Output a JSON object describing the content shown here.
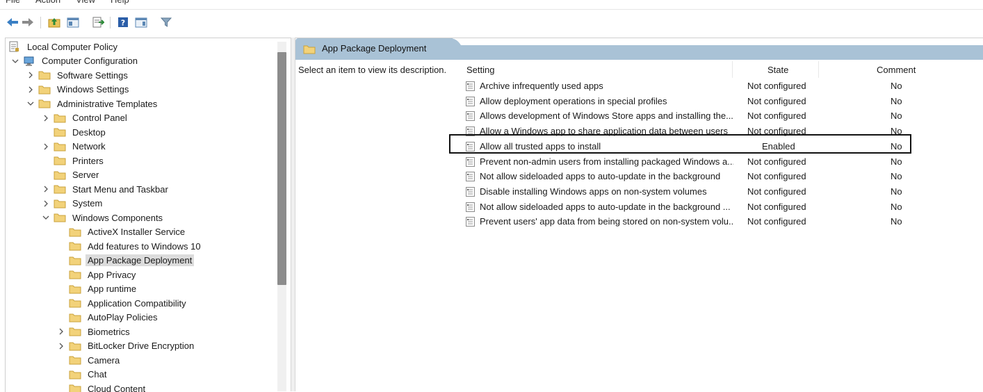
{
  "menubar": {
    "items": [
      "File",
      "Action",
      "View",
      "Help"
    ]
  },
  "toolbar": {
    "icons": [
      "back-arrow-icon",
      "forward-arrow-icon",
      "up-folder-icon",
      "show-hide-tree-icon",
      "export-list-icon",
      "help-icon",
      "show-hide-action-pane-icon",
      "filter-icon"
    ]
  },
  "tree": {
    "items": [
      {
        "label": "Local Computer Policy",
        "level": 0,
        "toggle": "none",
        "icon": "policy-icon"
      },
      {
        "label": "Computer Configuration",
        "level": 1,
        "toggle": "expanded",
        "icon": "computer-icon"
      },
      {
        "label": "Software Settings",
        "level": 2,
        "toggle": "collapsed",
        "icon": "folder-icon"
      },
      {
        "label": "Windows Settings",
        "level": 2,
        "toggle": "collapsed",
        "icon": "folder-icon"
      },
      {
        "label": "Administrative Templates",
        "level": 2,
        "toggle": "expanded",
        "icon": "folder-icon"
      },
      {
        "label": "Control Panel",
        "level": 3,
        "toggle": "collapsed",
        "icon": "folder-icon"
      },
      {
        "label": "Desktop",
        "level": 3,
        "toggle": "none",
        "icon": "folder-icon"
      },
      {
        "label": "Network",
        "level": 3,
        "toggle": "collapsed",
        "icon": "folder-icon"
      },
      {
        "label": "Printers",
        "level": 3,
        "toggle": "none",
        "icon": "folder-icon"
      },
      {
        "label": "Server",
        "level": 3,
        "toggle": "none",
        "icon": "folder-icon"
      },
      {
        "label": "Start Menu and Taskbar",
        "level": 3,
        "toggle": "collapsed",
        "icon": "folder-icon"
      },
      {
        "label": "System",
        "level": 3,
        "toggle": "collapsed",
        "icon": "folder-icon"
      },
      {
        "label": "Windows Components",
        "level": 3,
        "toggle": "expanded",
        "icon": "folder-icon"
      },
      {
        "label": "ActiveX Installer Service",
        "level": 4,
        "toggle": "none",
        "icon": "folder-icon"
      },
      {
        "label": "Add features to Windows 10",
        "level": 4,
        "toggle": "none",
        "icon": "folder-icon"
      },
      {
        "label": "App Package Deployment",
        "level": 4,
        "toggle": "none",
        "icon": "folder-icon",
        "selected": true
      },
      {
        "label": "App Privacy",
        "level": 4,
        "toggle": "none",
        "icon": "folder-icon"
      },
      {
        "label": "App runtime",
        "level": 4,
        "toggle": "none",
        "icon": "folder-icon"
      },
      {
        "label": "Application Compatibility",
        "level": 4,
        "toggle": "none",
        "icon": "folder-icon"
      },
      {
        "label": "AutoPlay Policies",
        "level": 4,
        "toggle": "none",
        "icon": "folder-icon"
      },
      {
        "label": "Biometrics",
        "level": 4,
        "toggle": "collapsed",
        "icon": "folder-icon"
      },
      {
        "label": "BitLocker Drive Encryption",
        "level": 4,
        "toggle": "collapsed",
        "icon": "folder-icon"
      },
      {
        "label": "Camera",
        "level": 4,
        "toggle": "none",
        "icon": "folder-icon"
      },
      {
        "label": "Chat",
        "level": 4,
        "toggle": "none",
        "icon": "folder-icon"
      },
      {
        "label": "Cloud Content",
        "level": 4,
        "toggle": "none",
        "icon": "folder-icon"
      }
    ]
  },
  "right": {
    "header_title": "App Package Deployment",
    "description_hint": "Select an item to view its description.",
    "columns": {
      "setting": "Setting",
      "state": "State",
      "comment": "Comment"
    },
    "rows": [
      {
        "name": "Archive infrequently used apps",
        "state": "Not configured",
        "comment": "No"
      },
      {
        "name": "Allow deployment operations in special profiles",
        "state": "Not configured",
        "comment": "No"
      },
      {
        "name": "Allows development of Windows Store apps and installing the...",
        "state": "Not configured",
        "comment": "No"
      },
      {
        "name": "Allow a Windows app to share application data between users",
        "state": "Not configured",
        "comment": "No"
      },
      {
        "name": "Allow all trusted apps to install",
        "state": "Enabled",
        "comment": "No",
        "highlighted": true
      },
      {
        "name": "Prevent non-admin users from installing packaged Windows a...",
        "state": "Not configured",
        "comment": "No"
      },
      {
        "name": "Not allow sideloaded apps to auto-update in the background",
        "state": "Not configured",
        "comment": "No"
      },
      {
        "name": "Disable installing Windows apps on non-system volumes",
        "state": "Not configured",
        "comment": "No"
      },
      {
        "name": "Not allow sideloaded apps to auto-update in the background ...",
        "state": "Not configured",
        "comment": "No"
      },
      {
        "name": "Prevent users' app data from being stored on non-system volu...",
        "state": "Not configured",
        "comment": "No"
      }
    ]
  },
  "colors": {
    "header_band": "#a9c2d6",
    "folder_fill": "#f2d27a",
    "selection": "#dcdcdc",
    "highlight_border": "#111111"
  }
}
